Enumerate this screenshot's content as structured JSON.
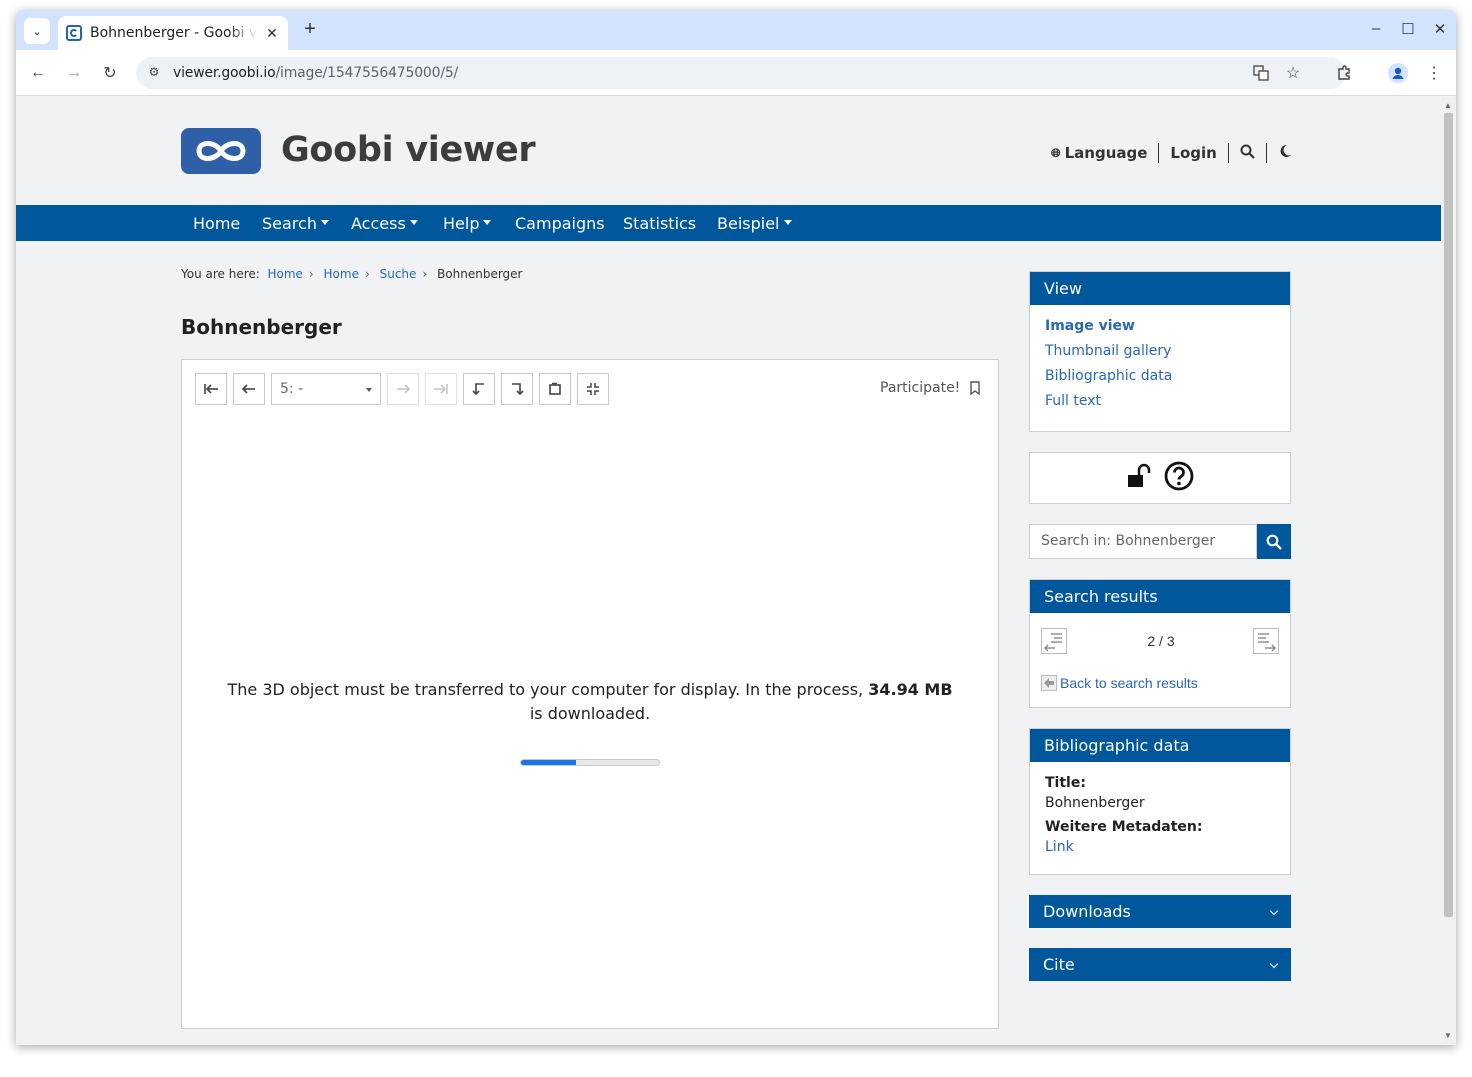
{
  "browser": {
    "tab_title": "Bohnenberger - Goobi viewer",
    "url_host": "viewer.goobi.io",
    "url_path": "/image/1547556475000/5/"
  },
  "header": {
    "site_title": "Goobi viewer",
    "language_label": "Language",
    "login_label": "Login"
  },
  "nav": {
    "home": "Home",
    "search": "Search",
    "access": "Access",
    "help": "Help",
    "campaigns": "Campaigns",
    "statistics": "Statistics",
    "beispiel": "Beispiel"
  },
  "breadcrumb": {
    "prefix": "You are here:",
    "items": [
      "Home",
      "Home",
      "Suche"
    ],
    "current": "Bohnenberger"
  },
  "page_heading": "Bohnenberger",
  "viewer": {
    "page_select_value": "5: -",
    "participate_label": "Participate!",
    "message_pre": "The 3D object must be transferred to your computer for display. In the process,",
    "message_size": "34.94 MB",
    "message_post": "is downloaded.",
    "progress_fraction": 0.4
  },
  "sidebar": {
    "view": {
      "title": "View",
      "links": [
        "Image view",
        "Thumbnail gallery",
        "Bibliographic data",
        "Full text"
      ]
    },
    "search_placeholder": "Search in: Bohnenberger",
    "search_results": {
      "title": "Search results",
      "counter": "2 / 3",
      "back_label": "Back to search results"
    },
    "biblio": {
      "title": "Bibliographic data",
      "title_label": "Title:",
      "title_value": "Bohnenberger",
      "more_label": "Weitere Metadaten:",
      "more_value": "Link"
    },
    "downloads_label": "Downloads",
    "cite_label": "Cite"
  },
  "colors": {
    "brand_blue": "#00579b",
    "link_blue": "#2a68b3",
    "progress_blue": "#1a73e8"
  }
}
